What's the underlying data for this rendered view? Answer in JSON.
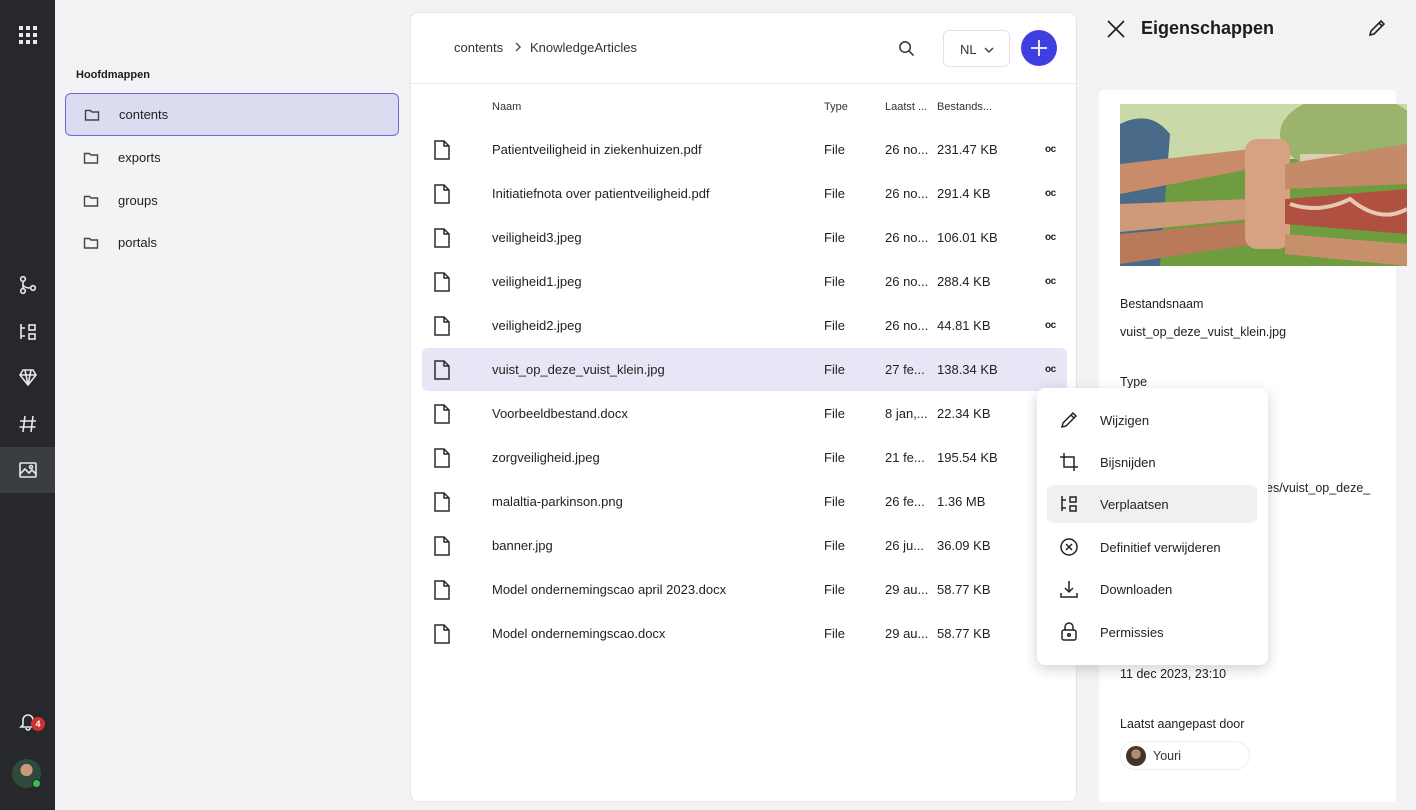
{
  "sidebar_rail": {
    "notification_count": "4"
  },
  "folders": {
    "title": "Hoofdmappen",
    "items": [
      {
        "label": "contents",
        "active": true
      },
      {
        "label": "exports"
      },
      {
        "label": "groups"
      },
      {
        "label": "portals"
      }
    ]
  },
  "toolbar": {
    "breadcrumb": [
      "contents",
      "KnowledgeArticles"
    ],
    "language": "NL"
  },
  "table": {
    "columns": [
      "Naam",
      "Type",
      "Laatst ...",
      "Bestands..."
    ],
    "rows": [
      {
        "name": "Patientveiligheid in ziekenhuizen.pdf",
        "type": "File",
        "modified": "26 no...",
        "size": "231.47 KB",
        "more": "oc"
      },
      {
        "name": "Initiatiefnota over patientveiligheid.pdf",
        "type": "File",
        "modified": "26 no...",
        "size": "291.4 KB",
        "more": "oc"
      },
      {
        "name": "veiligheid3.jpeg",
        "type": "File",
        "modified": "26 no...",
        "size": "106.01 KB",
        "more": "oc"
      },
      {
        "name": "veiligheid1.jpeg",
        "type": "File",
        "modified": "26 no...",
        "size": "288.4 KB",
        "more": "oc"
      },
      {
        "name": "veiligheid2.jpeg",
        "type": "File",
        "modified": "26 no...",
        "size": "44.81 KB",
        "more": "oc"
      },
      {
        "name": "vuist_op_deze_vuist_klein.jpg",
        "type": "File",
        "modified": "27 fe...",
        "size": "138.34 KB",
        "more": "oc",
        "selected": true
      },
      {
        "name": "Voorbeeldbestand.docx",
        "type": "File",
        "modified": "8 jan,...",
        "size": "22.34 KB"
      },
      {
        "name": "zorgveiligheid.jpeg",
        "type": "File",
        "modified": "21 fe...",
        "size": "195.54 KB"
      },
      {
        "name": "malaltia-parkinson.png",
        "type": "File",
        "modified": "26 fe...",
        "size": "1.36 MB"
      },
      {
        "name": "banner.jpg",
        "type": "File",
        "modified": "26 ju...",
        "size": "36.09 KB"
      },
      {
        "name": "Model ondernemingscao april 2023.docx",
        "type": "File",
        "modified": "29 au...",
        "size": "58.77 KB"
      },
      {
        "name": "Model ondernemingscao.docx",
        "type": "File",
        "modified": "29 au...",
        "size": "58.77 KB"
      }
    ]
  },
  "properties": {
    "title": "Eigenschappen",
    "filename_label": "Bestandsnaam",
    "filename_value": "vuist_op_deze_vuist_klein.jpg",
    "type_label": "Type",
    "path_fragment": "es/vuist_op_deze_",
    "date_value": "11 dec 2023, 23:10",
    "modified_by_label": "Laatst aangepast door",
    "modified_by_user": "Youri"
  },
  "context_menu": {
    "items": [
      {
        "label": "Wijzigen",
        "icon": "pencil-icon"
      },
      {
        "label": "Bijsnijden",
        "icon": "crop-icon"
      },
      {
        "label": "Verplaatsen",
        "icon": "move-icon",
        "hover": true
      },
      {
        "label": "Definitief verwijderen",
        "icon": "delete-circle-icon"
      },
      {
        "label": "Downloaden",
        "icon": "download-icon"
      },
      {
        "label": "Permissies",
        "icon": "lock-icon"
      }
    ]
  },
  "colors": {
    "accent": "#3d3fe0",
    "rail": "#26282b",
    "selected_row": "#e6e6f6",
    "active_folder": "#dcdcf0",
    "badge": "#d42f2f"
  }
}
